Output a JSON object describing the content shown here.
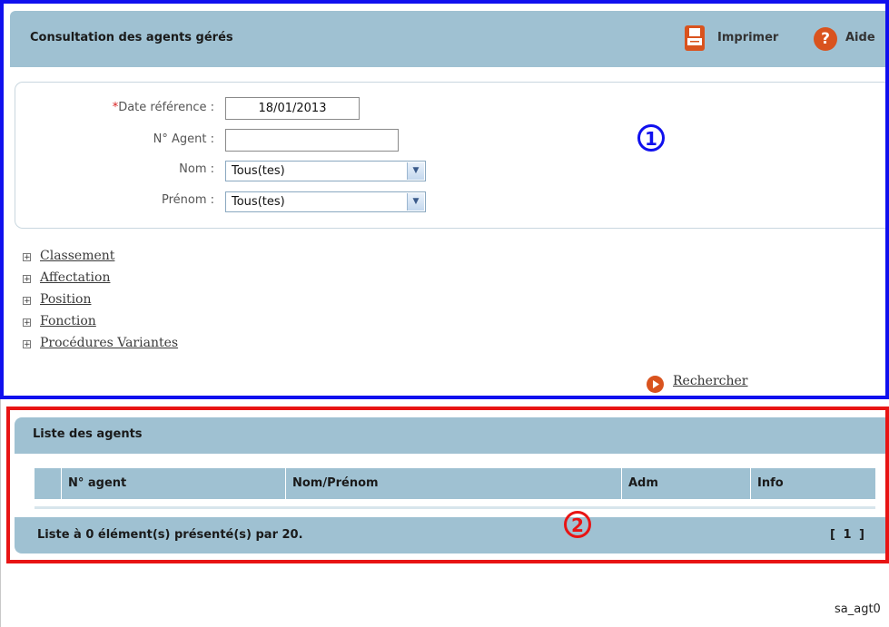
{
  "header": {
    "title": "Consultation des agents gérés",
    "print_label": "Imprimer",
    "help_label": "Aide",
    "help_glyph": "?"
  },
  "criteria": {
    "date_required_mark": "*",
    "date_label": "Date référence :",
    "date_value": "18/01/2013",
    "agent_label": "N° Agent :",
    "agent_value": "",
    "nom_label": "Nom :",
    "nom_value": "Tous(tes)",
    "prenom_label": "Prénom :",
    "prenom_value": "Tous(tes)"
  },
  "annotations": {
    "marker1": "1",
    "marker2": "2",
    "box1_color": "#1010ee",
    "box2_color": "#e81414"
  },
  "filters": [
    {
      "label": "Classement"
    },
    {
      "label": "Affectation"
    },
    {
      "label": "Position"
    },
    {
      "label": "Fonction"
    },
    {
      "label": "Procédures Variantes"
    }
  ],
  "search_label": "Rechercher",
  "results": {
    "title": "Liste des agents",
    "columns": [
      "N° agent",
      "Nom/Prénom",
      "Adm",
      "Info"
    ],
    "footer_text": "Liste à 0 élément(s) présenté(s) par 20.",
    "pager": "[ 1 ]"
  },
  "screen_code": "sa_agt0",
  "colors": {
    "header_bg": "#9fc1d2",
    "accent_orange": "#d9531e"
  },
  "icons": {
    "print": "printer-icon",
    "help": "help-icon",
    "search": "play-arrow-icon",
    "expand": "plus-box-icon"
  }
}
